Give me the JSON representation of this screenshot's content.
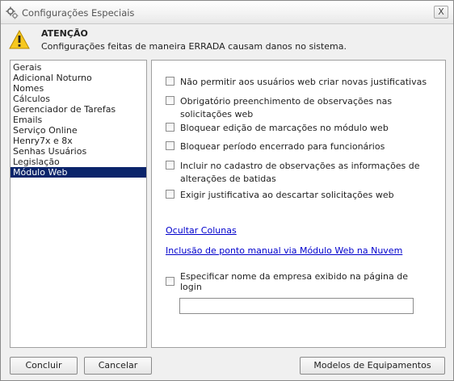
{
  "window": {
    "title": "Configurações Especiais",
    "close_label": "X",
    "title_icon": "gear-icon"
  },
  "warning": {
    "icon": "warning-triangle-icon",
    "title": "ATENÇÃO",
    "message": "Configurações feitas de maneira ERRADA causam danos no sistema."
  },
  "sidebar": {
    "items": [
      {
        "label": "Gerais"
      },
      {
        "label": "Adicional Noturno"
      },
      {
        "label": "Nomes"
      },
      {
        "label": "Cálculos"
      },
      {
        "label": "Gerenciador de Tarefas"
      },
      {
        "label": "Emails"
      },
      {
        "label": "Serviço Online"
      },
      {
        "label": "Henry7x e 8x"
      },
      {
        "label": "Senhas Usuários"
      },
      {
        "label": "Legislação"
      },
      {
        "label": "Módulo Web"
      }
    ],
    "selected": "Módulo Web"
  },
  "options": {
    "opt1": {
      "label": "Não permitir aos usuários web criar novas justificativas",
      "checked": false
    },
    "opt2": {
      "label": "Obrigatório preenchimento de observações nas",
      "label2": "solicitações web",
      "checked": false
    },
    "opt3": {
      "label": "Bloquear edição de marcações no módulo web",
      "checked": false
    },
    "opt4": {
      "label": "Bloquear período encerrado para funcionários",
      "checked": false
    },
    "opt5": {
      "label": "Incluir no cadastro de observações as informações de",
      "label2": "alterações de batidas",
      "checked": false
    },
    "opt6": {
      "label": "Exigir justificativa ao descartar solicitações web",
      "checked": false
    }
  },
  "links": {
    "hide_columns": "Ocultar Colunas",
    "manual_punch": "Inclusão de ponto manual via Módulo Web na Nuvem"
  },
  "company_name": {
    "label": "Especificar nome da empresa exibido na página de",
    "label2": "login",
    "checked": false,
    "value": ""
  },
  "buttons": {
    "conclude": "Concluir",
    "cancel": "Cancelar",
    "models": "Modelos de Equipamentos"
  },
  "colors": {
    "selection": "#0a246a",
    "link": "#0000cc"
  }
}
